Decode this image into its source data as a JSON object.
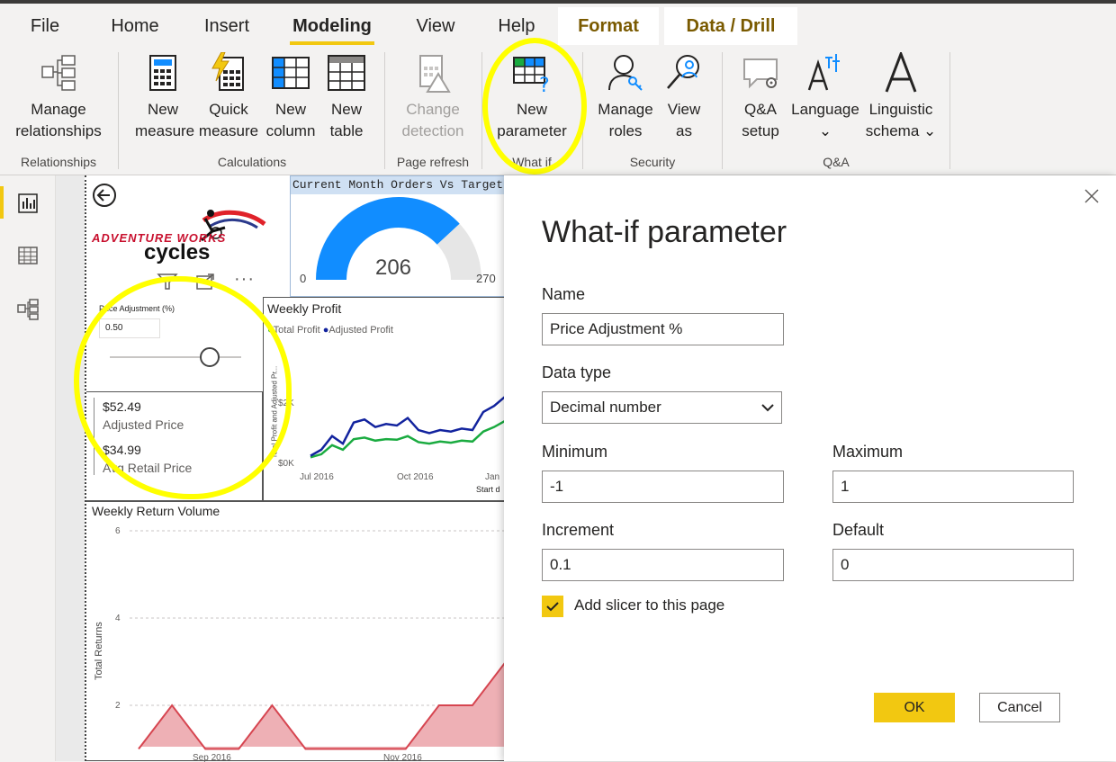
{
  "menu": {
    "tabs": [
      "File",
      "Home",
      "Insert",
      "Modeling",
      "View",
      "Help",
      "Format",
      "Data / Drill"
    ],
    "active": "Modeling"
  },
  "ribbon": {
    "buttons": [
      {
        "line1": "Manage",
        "line2": "relationships",
        "icon": "manage-relationships-icon",
        "enabled": true
      },
      {
        "line1": "New",
        "line2": "measure",
        "icon": "new-measure-icon",
        "enabled": true
      },
      {
        "line1": "Quick",
        "line2": "measure",
        "icon": "quick-measure-icon",
        "enabled": true
      },
      {
        "line1": "New",
        "line2": "column",
        "icon": "new-column-icon",
        "enabled": true
      },
      {
        "line1": "New",
        "line2": "table",
        "icon": "new-table-icon",
        "enabled": true
      },
      {
        "line1": "Change",
        "line2": "detection",
        "icon": "change-detection-icon",
        "enabled": false
      },
      {
        "line1": "New",
        "line2": "parameter",
        "icon": "new-parameter-icon",
        "enabled": true
      },
      {
        "line1": "Manage",
        "line2": "roles",
        "icon": "manage-roles-icon",
        "enabled": true
      },
      {
        "line1": "View",
        "line2": "as",
        "icon": "view-as-icon",
        "enabled": true
      },
      {
        "line1": "Q&A",
        "line2": "setup",
        "icon": "qa-setup-icon",
        "enabled": true
      },
      {
        "line1": "Language",
        "line2": "⌄",
        "icon": "language-icon",
        "enabled": true
      },
      {
        "line1": "Linguistic",
        "line2": "schema ⌄",
        "icon": "linguistic-schema-icon",
        "enabled": true
      }
    ],
    "groups": [
      "Relationships",
      "Calculations",
      "Page refresh",
      "What if",
      "Security",
      "Q&A"
    ]
  },
  "report": {
    "logo_text_1": "ADVENTURE WORKS",
    "logo_text_2": "cycles",
    "gauge": {
      "title": "Current Month Orders Vs Target",
      "value": "206",
      "min": "0",
      "max": "270",
      "fraction": 0.763
    },
    "slicer": {
      "title": "Price Adjustment (%)",
      "value": "0.50"
    },
    "cards": {
      "adjusted_price": "$52.49",
      "adjusted_label": "Adjusted Price",
      "avg_price": "$34.99",
      "avg_label": "Avg Retail Price"
    },
    "weekly_profit": {
      "title": "Weekly Profit",
      "legend": [
        "Total Profit",
        "Adjusted Profit"
      ],
      "ylabel": "Total Profit and Adjusted Pr...",
      "yticks": [
        "$2K",
        "$0K"
      ],
      "xticks": [
        "Jul 2016",
        "Oct 2016",
        "Jan"
      ],
      "xlabel": "Start d"
    },
    "returns": {
      "title": "Weekly Return Volume",
      "ylabel": "Total Returns",
      "yticks": [
        "6",
        "4",
        "2"
      ],
      "xticks": [
        "Sep 2016",
        "Nov 2016"
      ]
    }
  },
  "chart_data": [
    {
      "type": "line",
      "title": "Weekly Profit",
      "ylabel": "Total Profit and Adjusted Pr...",
      "x": [
        "Jul 2016",
        "",
        "",
        "",
        "",
        "",
        "",
        "",
        "",
        "Oct 2016",
        "",
        "",
        "",
        "",
        "",
        "",
        "",
        "",
        "Jan"
      ],
      "series": [
        {
          "name": "Total Profit",
          "color": "#1aab40",
          "values": [
            0.2,
            0.3,
            0.6,
            0.45,
            0.8,
            0.85,
            0.75,
            0.8,
            0.78,
            0.9,
            0.7,
            0.65,
            0.72,
            0.68,
            0.75,
            0.72,
            1.05,
            1.2,
            1.4
          ]
        },
        {
          "name": "Adjusted Profit",
          "color": "#12239e",
          "values": [
            0.25,
            0.45,
            0.9,
            0.65,
            1.35,
            1.45,
            1.2,
            1.3,
            1.25,
            1.5,
            1.1,
            1.0,
            1.1,
            1.05,
            1.15,
            1.1,
            1.7,
            1.9,
            2.2
          ]
        }
      ],
      "ylim": [
        0,
        2.5
      ]
    },
    {
      "type": "area",
      "title": "Weekly Return Volume",
      "ylabel": "Total Returns",
      "x": [
        "Sep 2016",
        "",
        "",
        "",
        "",
        "",
        "",
        "",
        "Nov 2016",
        "",
        "",
        ""
      ],
      "series": [
        {
          "name": "Total Returns",
          "color": "#d64550",
          "values": [
            1,
            2,
            1,
            1,
            2,
            1,
            1,
            1,
            1,
            2,
            2,
            3
          ]
        }
      ],
      "ylim": [
        1,
        6.5
      ]
    }
  ],
  "dialog": {
    "title": "What-if parameter",
    "name_label": "Name",
    "name_value": "Price Adjustment %",
    "type_label": "Data type",
    "type_value": "Decimal number",
    "min_label": "Minimum",
    "min_value": "-1",
    "max_label": "Maximum",
    "max_value": "1",
    "inc_label": "Increment",
    "inc_value": "0.1",
    "def_label": "Default",
    "def_value": "0",
    "checkbox_label": "Add slicer to this page",
    "checkbox_checked": true,
    "ok": "OK",
    "cancel": "Cancel"
  },
  "colors": {
    "accent": "#f2c811",
    "highlight": "#ffff00"
  }
}
